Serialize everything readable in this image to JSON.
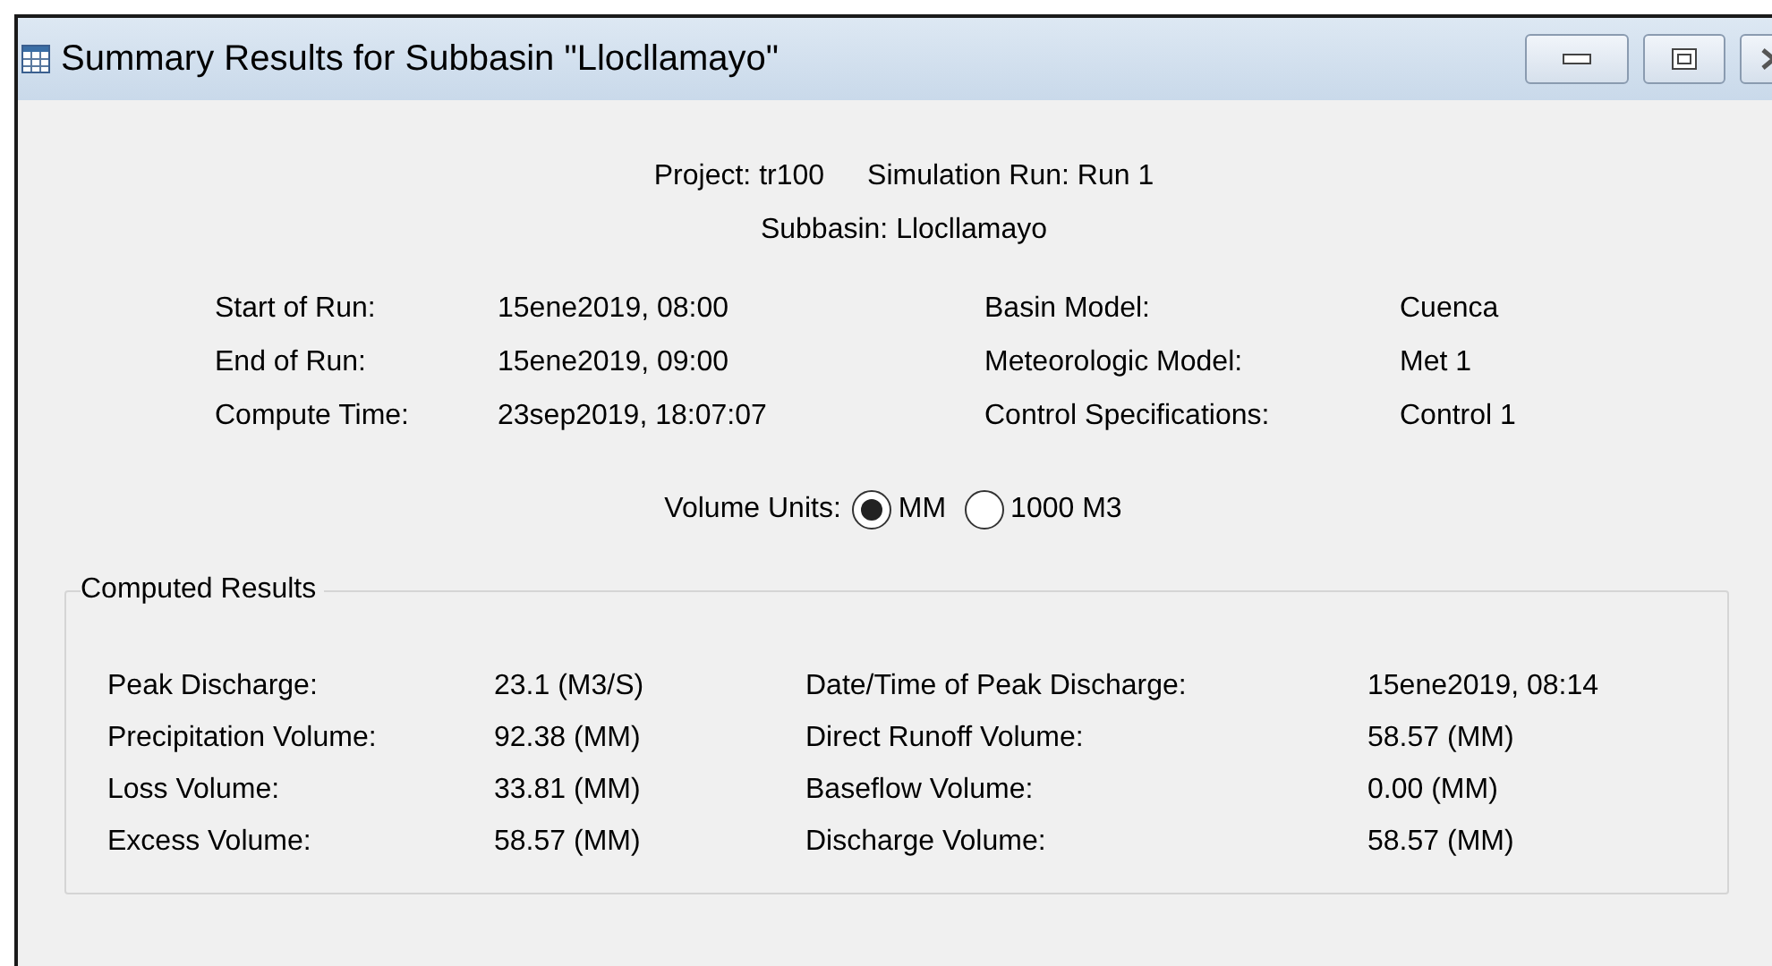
{
  "window": {
    "title": "Summary Results for Subbasin \"Llocllamayo\""
  },
  "header": [
    {
      "label": "Project:",
      "value": "tr100"
    },
    {
      "label": "Simulation Run:",
      "value": "Run 1"
    },
    {
      "label": "Subbasin:",
      "value": "Llocllamayo"
    }
  ],
  "run_info": {
    "left": [
      {
        "label": "Start of Run:",
        "value": "15ene2019, 08:00"
      },
      {
        "label": "End of Run:",
        "value": "15ene2019, 09:00"
      },
      {
        "label": "Compute Time:",
        "value": "23sep2019, 18:07:07"
      }
    ],
    "right": [
      {
        "label": "Basin Model:",
        "value": "Cuenca"
      },
      {
        "label": "Meteorologic Model:",
        "value": "Met 1"
      },
      {
        "label": "Control Specifications:",
        "value": "Control 1"
      }
    ]
  },
  "volume_units": {
    "label": "Volume Units:",
    "options": [
      {
        "label": "MM",
        "selected": true
      },
      {
        "label": "1000 M3",
        "selected": false
      }
    ]
  },
  "computed_results": {
    "title": "Computed Results",
    "left": [
      {
        "label": "Peak Discharge:",
        "value": "23.1 (M3/S)"
      },
      {
        "label": "Precipitation Volume:",
        "value": "92.38 (MM)"
      },
      {
        "label": "Loss Volume:",
        "value": "33.81 (MM)"
      },
      {
        "label": "Excess Volume:",
        "value": "58.57 (MM)"
      }
    ],
    "right": [
      {
        "label": "Date/Time of Peak Discharge:",
        "value": "15ene2019, 08:14"
      },
      {
        "label": "Direct Runoff Volume:",
        "value": "58.57 (MM)"
      },
      {
        "label": "Baseflow Volume:",
        "value": "0.00 (MM)"
      },
      {
        "label": "Discharge Volume:",
        "value": "58.57 (MM)"
      }
    ]
  }
}
